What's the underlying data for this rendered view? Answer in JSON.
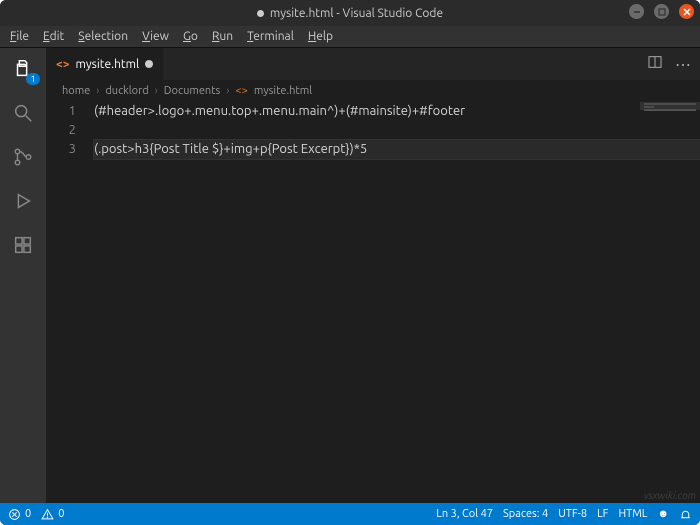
{
  "titlebar": {
    "title": "mysite.html - Visual Studio Code",
    "modified": true
  },
  "menubar": {
    "items": [
      "File",
      "Edit",
      "Selection",
      "View",
      "Go",
      "Run",
      "Terminal",
      "Help"
    ]
  },
  "activitybar": {
    "items": [
      {
        "name": "explorer-icon",
        "badge": "1"
      },
      {
        "name": "search-icon"
      },
      {
        "name": "source-control-icon"
      },
      {
        "name": "run-debug-icon"
      },
      {
        "name": "extensions-icon"
      }
    ]
  },
  "tabs": {
    "items": [
      {
        "label": "mysite.html",
        "dirty": true,
        "icon": "html"
      }
    ]
  },
  "breadcrumb": {
    "segments": [
      "home",
      "ducklord",
      "Documents",
      "mysite.html"
    ]
  },
  "editor": {
    "lines": [
      "(#header>.logo+.menu.top+.menu.main^)+(#mainsite)+#footer",
      "",
      "(.post>h3{Post Title $}+img+p{Post Excerpt})*5"
    ],
    "cursor": {
      "line": 3,
      "col": 47
    }
  },
  "statusbar": {
    "errors": "0",
    "warnings": "0",
    "lncol": "Ln 3, Col 47",
    "spaces": "Spaces: 4",
    "encoding": "UTF-8",
    "eol": "LF",
    "language": "HTML",
    "feedback": "☻"
  },
  "watermark": "vsxwiki.com"
}
